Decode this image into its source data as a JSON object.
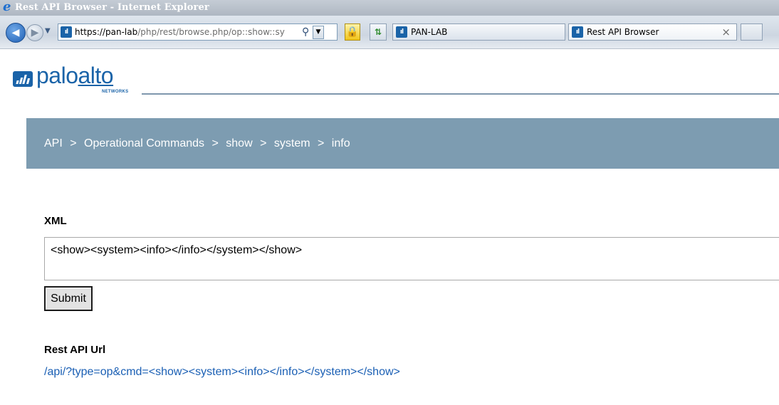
{
  "window": {
    "title": "Rest API Browser - Internet Explorer"
  },
  "toolbar": {
    "address_host": "https://pan-lab",
    "address_path": "/php/rest/browse.php/op::show::sy",
    "icons": [
      "back-arrow-icon",
      "forward-arrow-icon",
      "search-icon",
      "lock-icon",
      "refresh-icon"
    ]
  },
  "tabs": [
    {
      "label": "PAN-LAB"
    },
    {
      "label": "Rest API Browser",
      "close": "×"
    }
  ],
  "logo": {
    "palo": "palo",
    "alto": "alto",
    "networks": "NETWORKS",
    "brand_color": "#1a63a8"
  },
  "breadcrumb": {
    "items": [
      "API",
      "Operational Commands",
      "show",
      "system",
      "info"
    ],
    "separator": ">",
    "band_color": "#7d9cb1"
  },
  "xml": {
    "label": "XML",
    "value": "<show><system><info></info></system></show>"
  },
  "submit": {
    "label": "Submit"
  },
  "rest_api_url": {
    "label": "Rest API Url",
    "value": "/api/?type=op&cmd=<show><system><info></info></system></show>",
    "link_color": "#1a5fb4"
  }
}
